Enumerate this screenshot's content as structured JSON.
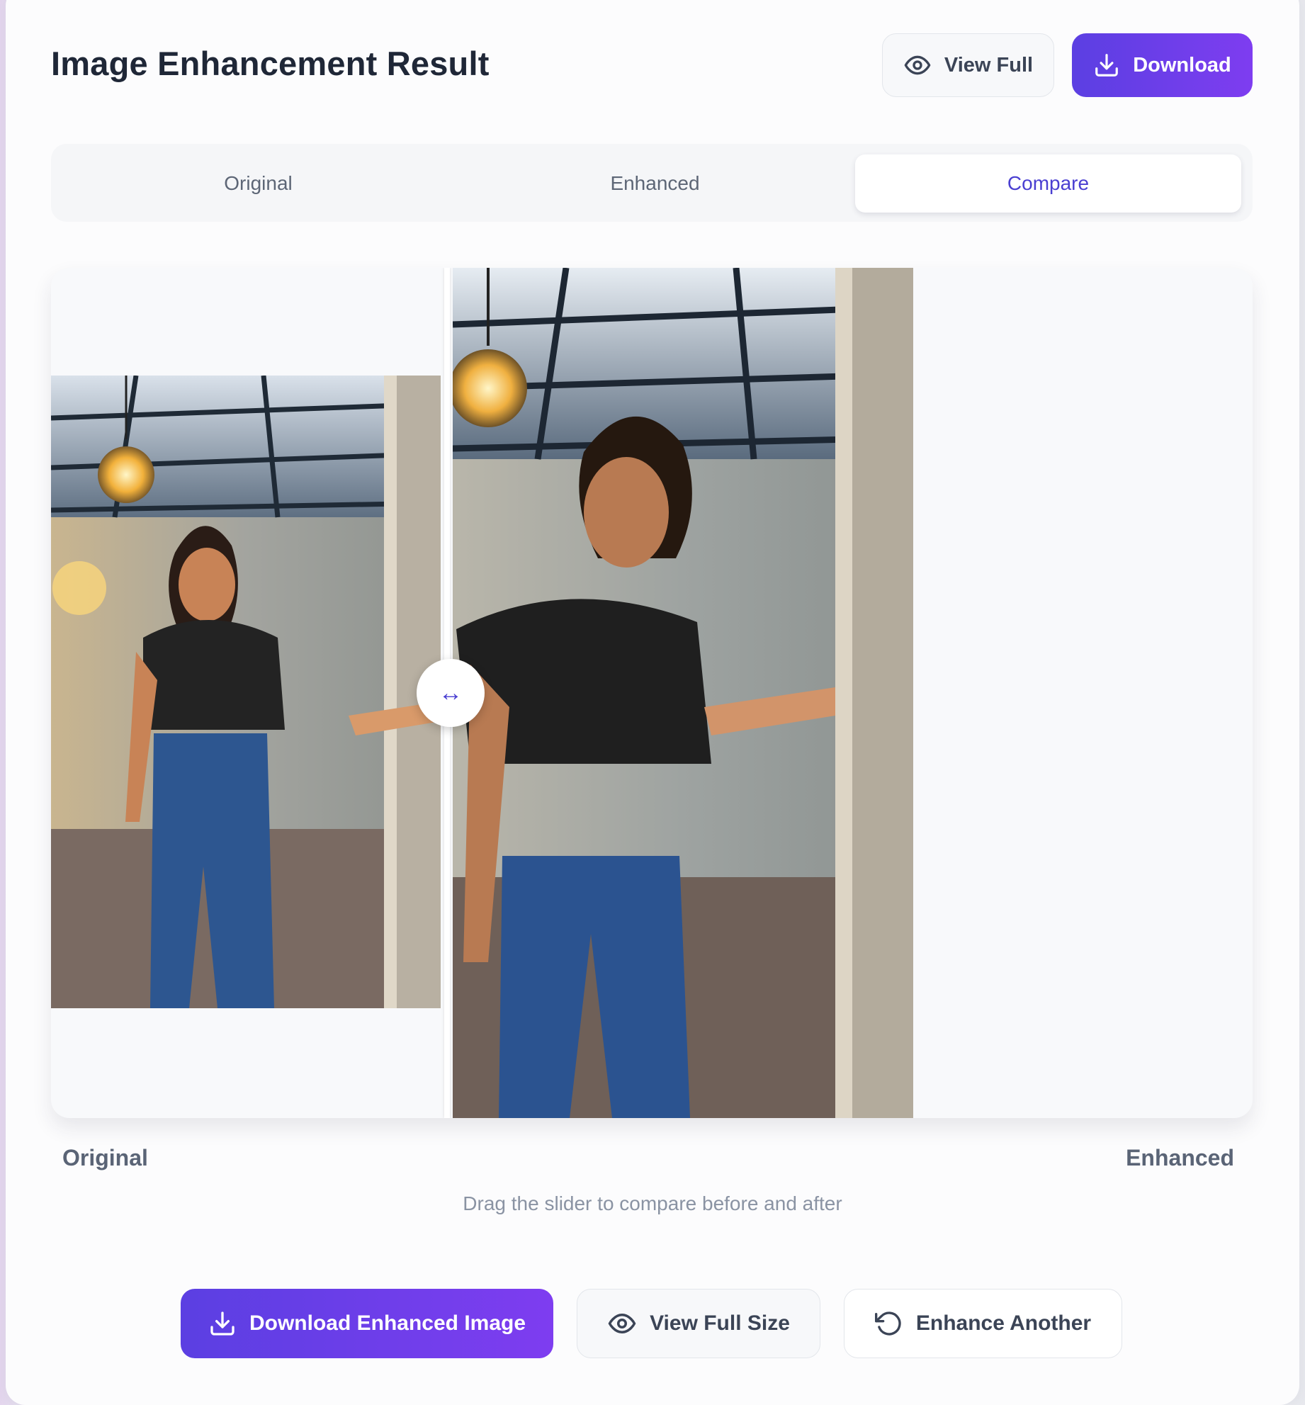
{
  "header": {
    "title": "Image Enhancement Result",
    "view_full_label": "View Full",
    "download_label": "Download"
  },
  "tabs": [
    {
      "label": "Original",
      "active": false
    },
    {
      "label": "Enhanced",
      "active": false
    },
    {
      "label": "Compare",
      "active": true
    }
  ],
  "compare": {
    "left_label": "Original",
    "right_label": "Enhanced",
    "hint": "Drag the slider to compare before and after",
    "handle_glyph": "↔"
  },
  "actions": {
    "download_enhanced_label": "Download Enhanced Image",
    "view_full_size_label": "View Full Size",
    "enhance_another_label": "Enhance Another"
  },
  "icons": {
    "eye": "eye-icon",
    "download": "download-icon",
    "refresh": "rotate-ccw-icon",
    "slider": "arrows-left-right-icon"
  },
  "colors": {
    "accent": "#5b3fe2",
    "accent_end": "#7e3df0",
    "active_tab_text": "#4a3fd1"
  }
}
